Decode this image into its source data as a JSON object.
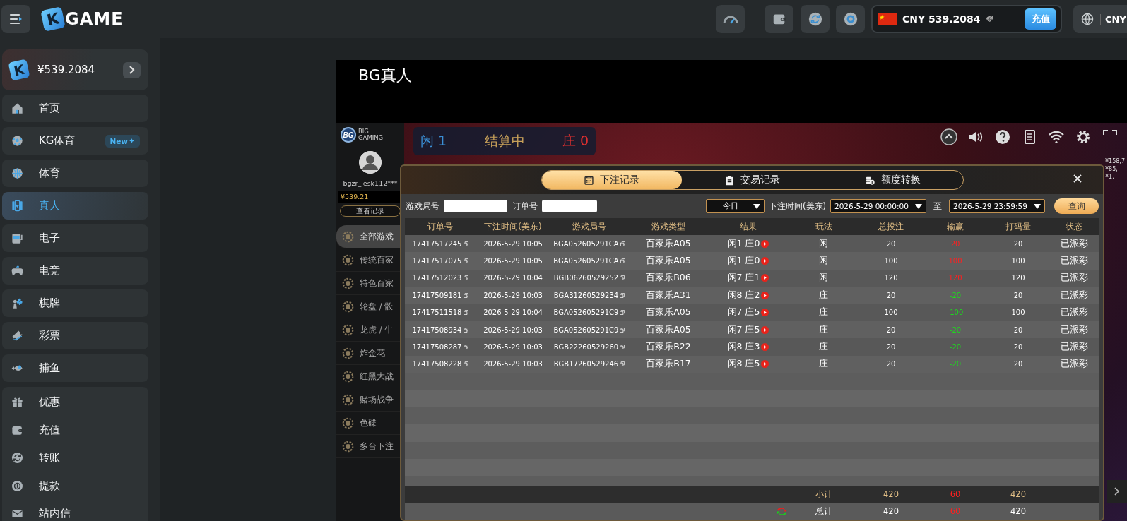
{
  "topbar": {
    "logo_mark": "K",
    "logo_text": "GAME",
    "balance": "CNY 539.2084",
    "deposit_button": "充值",
    "currency": "CNY"
  },
  "sidebar": {
    "wallet": {
      "logo_mark": "K",
      "balance": "¥539.2084"
    },
    "nav_items": [
      {
        "label": "首页",
        "selected": false
      },
      {
        "label": "KG体育",
        "selected": false,
        "badge": "New"
      },
      {
        "label": "体育",
        "selected": false
      },
      {
        "label": "真人",
        "selected": true
      },
      {
        "label": "电子",
        "selected": false
      },
      {
        "label": "电竞",
        "selected": false
      },
      {
        "label": "棋牌",
        "selected": false
      },
      {
        "label": "彩票",
        "selected": false
      },
      {
        "label": "捕鱼",
        "selected": false
      }
    ],
    "service_items": [
      {
        "label": "优惠"
      },
      {
        "label": "充值"
      },
      {
        "label": "转账"
      },
      {
        "label": "提款"
      },
      {
        "label": "站内信"
      }
    ]
  },
  "page_title": "BG真人",
  "game": {
    "logo_mark": "BG",
    "brand": [
      "BIG",
      "GAMING"
    ],
    "username": "bgzr_lesk112***",
    "balance": "¥539.21",
    "records_button": "查看记录",
    "categories": [
      {
        "label": "全部游戏",
        "selected": true
      },
      {
        "label": "传统百家",
        "selected": false
      },
      {
        "label": "特色百家",
        "selected": false
      },
      {
        "label": "轮盘 / 骰",
        "selected": false
      },
      {
        "label": "龙虎 / 牛",
        "selected": false
      },
      {
        "label": "炸金花",
        "selected": false
      },
      {
        "label": "红黑大战",
        "selected": false
      },
      {
        "label": "赌场战争",
        "selected": false
      },
      {
        "label": "色碟",
        "selected": false
      },
      {
        "label": "多台下注",
        "selected": false
      }
    ],
    "scoreboard": {
      "player": "闲 1",
      "status": "结算中",
      "banker": "庄 0"
    },
    "side_amounts": [
      "¥158,7",
      "¥85,",
      "¥1,"
    ]
  },
  "modal": {
    "tabs": [
      {
        "label": "下注记录",
        "selected": true
      },
      {
        "label": "交易记录",
        "selected": false
      },
      {
        "label": "额度转换",
        "selected": false
      }
    ],
    "filters": {
      "round_label": "游戏局号",
      "order_label": "订单号",
      "period": "今日",
      "time_label": "下注时间(美东)",
      "start": "2026-5-29 00:00:00",
      "separator": "至",
      "end": "2026-5-29 23:59:59",
      "search_button": "查询"
    },
    "table": {
      "columns": [
        "订单号",
        "下注时间(美东)",
        "游戏局号",
        "游戏类型",
        "结果",
        "玩法",
        "总投注",
        "输赢",
        "打码量",
        "状态"
      ],
      "rows": [
        {
          "order_no": "17417517245",
          "time": "2026-5-29 10:05",
          "round_no": "BGA052605291CA",
          "game_type": "百家乐A05",
          "result": "闲1 庄0",
          "play": "闲",
          "bet": "20",
          "win_loss": {
            "text": "20",
            "color": "#ff2020"
          },
          "turnover": "20",
          "status": "已派彩"
        },
        {
          "order_no": "17417517075",
          "time": "2026-5-29 10:05",
          "round_no": "BGA052605291CA",
          "game_type": "百家乐A05",
          "result": "闲1 庄0",
          "play": "闲",
          "bet": "100",
          "win_loss": {
            "text": "100",
            "color": "#ff2020"
          },
          "turnover": "100",
          "status": "已派彩"
        },
        {
          "order_no": "17417512023",
          "time": "2026-5-29 10:04",
          "round_no": "BGB06260529252",
          "game_type": "百家乐B06",
          "result": "闲7 庄1",
          "play": "闲",
          "bet": "120",
          "win_loss": {
            "text": "120",
            "color": "#ff2020"
          },
          "turnover": "120",
          "status": "已派彩"
        },
        {
          "order_no": "17417509181",
          "time": "2026-5-29 10:03",
          "round_no": "BGA31260529234",
          "game_type": "百家乐A31",
          "result": "闲8 庄2",
          "play": "庄",
          "bet": "20",
          "win_loss": {
            "text": "-20",
            "color": "#1ed81e"
          },
          "turnover": "20",
          "status": "已派彩"
        },
        {
          "order_no": "17417511518",
          "time": "2026-5-29 10:04",
          "round_no": "BGA052605291C9",
          "game_type": "百家乐A05",
          "result": "闲7 庄5",
          "play": "庄",
          "bet": "100",
          "win_loss": {
            "text": "-100",
            "color": "#1ed81e"
          },
          "turnover": "100",
          "status": "已派彩"
        },
        {
          "order_no": "17417508934",
          "time": "2026-5-29 10:03",
          "round_no": "BGA052605291C9",
          "game_type": "百家乐A05",
          "result": "闲7 庄5",
          "play": "庄",
          "bet": "20",
          "win_loss": {
            "text": "-20",
            "color": "#1ed81e"
          },
          "turnover": "20",
          "status": "已派彩"
        },
        {
          "order_no": "17417508287",
          "time": "2026-5-29 10:03",
          "round_no": "BGB22260529260",
          "game_type": "百家乐B22",
          "result": "闲8 庄3",
          "play": "庄",
          "bet": "20",
          "win_loss": {
            "text": "-20",
            "color": "#1ed81e"
          },
          "turnover": "20",
          "status": "已派彩"
        },
        {
          "order_no": "17417508228",
          "time": "2026-5-29 10:03",
          "round_no": "BGB17260529246",
          "game_type": "百家乐B17",
          "result": "闲8 庄5",
          "play": "庄",
          "bet": "20",
          "win_loss": {
            "text": "-20",
            "color": "#1ed81e"
          },
          "turnover": "20",
          "status": "已派彩"
        }
      ]
    },
    "subtotal": {
      "label": "小计",
      "bet": "420",
      "win_loss": "60",
      "turnover": "420"
    },
    "total": {
      "label": "总计",
      "bet": "420",
      "win_loss": "60",
      "turnover": "420"
    }
  }
}
